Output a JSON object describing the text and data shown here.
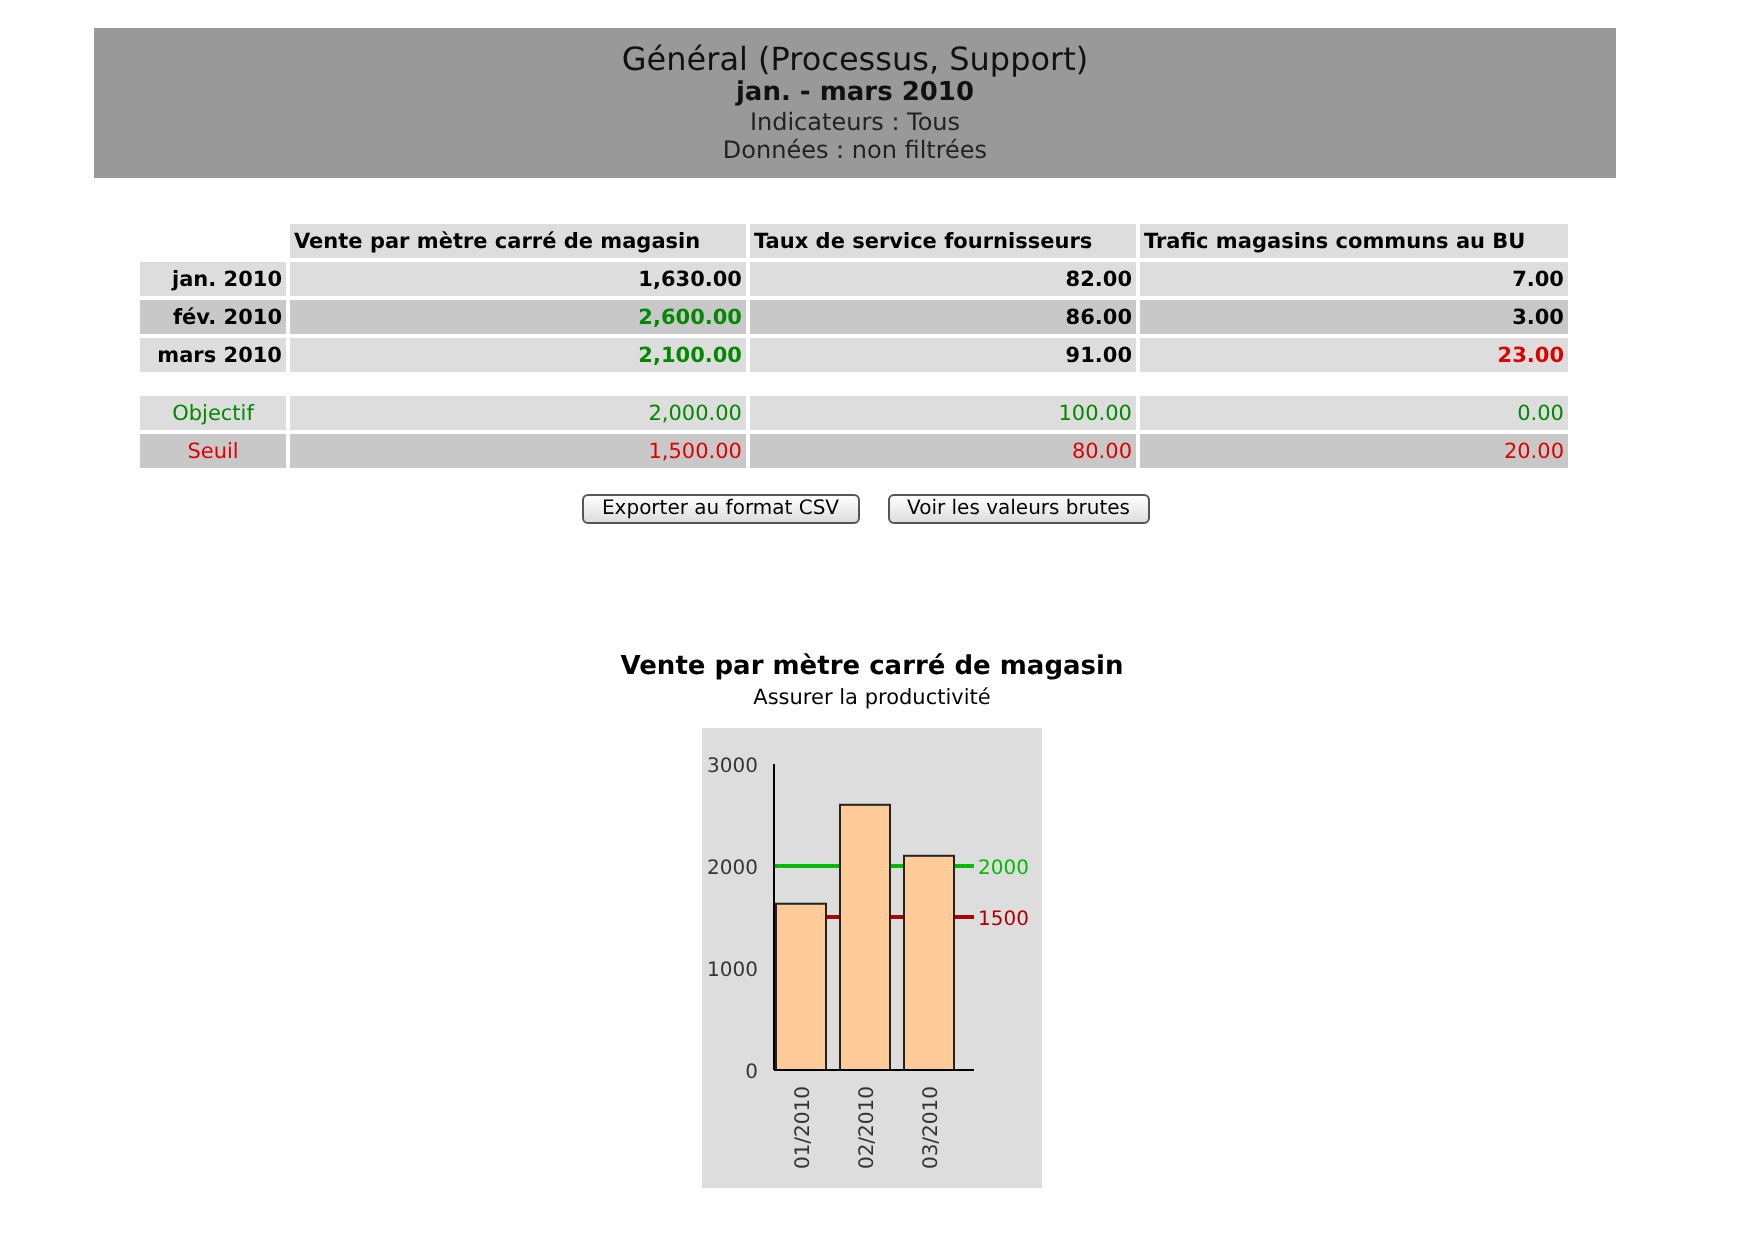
{
  "header": {
    "title": "Général (Processus, Support)",
    "period": "jan. - mars 2010",
    "lines": [
      "Indicateurs : Tous",
      "Données : non filtrées"
    ]
  },
  "table": {
    "columns": [
      "Vente par mètre carré de magasin",
      "Taux de service fournisseurs",
      "Trafic magasins communs au BU"
    ],
    "rows": [
      {
        "label": "jan. 2010",
        "cells": [
          {
            "text": "1,630.00",
            "color": "#000000"
          },
          {
            "text": "82.00",
            "color": "#000000"
          },
          {
            "text": "7.00",
            "color": "#000000"
          }
        ]
      },
      {
        "label": "fév. 2010",
        "cells": [
          {
            "text": "2,600.00",
            "color": "#008800"
          },
          {
            "text": "86.00",
            "color": "#000000"
          },
          {
            "text": "3.00",
            "color": "#000000"
          }
        ]
      },
      {
        "label": "mars 2010",
        "cells": [
          {
            "text": "2,100.00",
            "color": "#008800"
          },
          {
            "text": "91.00",
            "color": "#000000"
          },
          {
            "text": "23.00",
            "color": "#dd0000"
          }
        ]
      }
    ],
    "limits": [
      {
        "kind": "target",
        "label": "Objectif",
        "cells": [
          "2,000.00",
          "100.00",
          "0.00"
        ]
      },
      {
        "kind": "threshold",
        "label": "Seuil",
        "cells": [
          "1,500.00",
          "80.00",
          "20.00"
        ]
      }
    ]
  },
  "buttons": [
    "Exporter au format CSV",
    "Voir les valeurs brutes"
  ],
  "chart": {
    "title": "Vente par mètre carré de magasin",
    "subtitle": "Assurer la productivité",
    "chart_data": {
      "type": "bar",
      "categories": [
        "01/2010",
        "02/2010",
        "03/2010"
      ],
      "values": [
        1630,
        2600,
        2100
      ],
      "ylim": [
        0,
        3000
      ],
      "yticks": [
        0,
        1000,
        2000,
        3000
      ],
      "ref_lines": [
        {
          "axis": "y",
          "value": 2000,
          "label": "2000",
          "color": "#00bb00"
        },
        {
          "axis": "y",
          "value": 1500,
          "label": "1500",
          "color": "#aa0000"
        }
      ]
    }
  }
}
